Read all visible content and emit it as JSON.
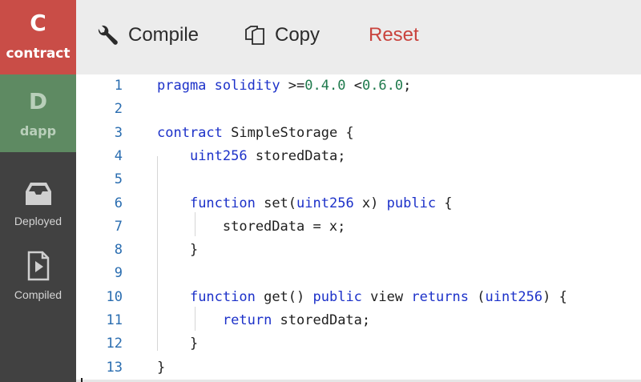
{
  "sidebar": {
    "contract": {
      "letter": "C",
      "label": "contract"
    },
    "dapp": {
      "letter": "D",
      "label": "dapp"
    },
    "deployed": {
      "label": "Deployed",
      "icon": "inbox-tray-icon"
    },
    "compiled": {
      "label": "Compiled",
      "icon": "play-file-icon"
    }
  },
  "toolbar": {
    "compile_label": "Compile",
    "copy_label": "Copy",
    "reset_label": "Reset"
  },
  "colors": {
    "contract_tile": "#c94d47",
    "dapp_tile": "#5e8a62",
    "sidebar_bg": "#414141",
    "toolbar_bg": "#ececec",
    "reset_text": "#c9433d",
    "keyword": "#1c31c9",
    "number": "#1f7a4d",
    "line_number": "#2a6db0"
  },
  "editor": {
    "lines": [
      {
        "no": "1",
        "tokens": [
          {
            "t": "pragma",
            "c": "kw"
          },
          {
            "t": " "
          },
          {
            "t": "solidity",
            "c": "kw"
          },
          {
            "t": " >="
          },
          {
            "t": "0.4.0",
            "c": "num"
          },
          {
            "t": " <"
          },
          {
            "t": "0.6.0",
            "c": "num"
          },
          {
            "t": ";"
          }
        ]
      },
      {
        "no": "2",
        "tokens": []
      },
      {
        "no": "3",
        "tokens": [
          {
            "t": "contract",
            "c": "kw"
          },
          {
            "t": " SimpleStorage {"
          }
        ]
      },
      {
        "no": "4",
        "tokens": [
          {
            "t": "    "
          },
          {
            "t": "uint256",
            "c": "kw"
          },
          {
            "t": " storedData;"
          }
        ]
      },
      {
        "no": "5",
        "tokens": []
      },
      {
        "no": "6",
        "tokens": [
          {
            "t": "    "
          },
          {
            "t": "function",
            "c": "kw"
          },
          {
            "t": " set("
          },
          {
            "t": "uint256",
            "c": "kw"
          },
          {
            "t": " x) "
          },
          {
            "t": "public",
            "c": "kw"
          },
          {
            "t": " {"
          }
        ]
      },
      {
        "no": "7",
        "tokens": [
          {
            "t": "        storedData = x;"
          }
        ]
      },
      {
        "no": "8",
        "tokens": [
          {
            "t": "    }"
          }
        ]
      },
      {
        "no": "9",
        "tokens": []
      },
      {
        "no": "10",
        "tokens": [
          {
            "t": "    "
          },
          {
            "t": "function",
            "c": "kw"
          },
          {
            "t": " get() "
          },
          {
            "t": "public",
            "c": "kw"
          },
          {
            "t": " view "
          },
          {
            "t": "returns",
            "c": "kw"
          },
          {
            "t": " ("
          },
          {
            "t": "uint256",
            "c": "kw"
          },
          {
            "t": ") {"
          }
        ]
      },
      {
        "no": "11",
        "tokens": [
          {
            "t": "        "
          },
          {
            "t": "return",
            "c": "kw"
          },
          {
            "t": " storedData;"
          }
        ]
      },
      {
        "no": "12",
        "tokens": [
          {
            "t": "    }"
          }
        ]
      },
      {
        "no": "13",
        "tokens": [
          {
            "t": "}"
          }
        ]
      }
    ]
  }
}
